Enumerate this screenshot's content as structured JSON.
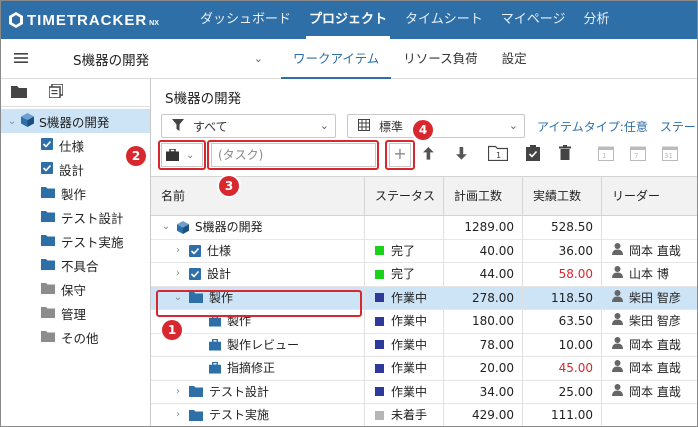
{
  "app": {
    "logo_text": "TIMETRACKER",
    "logo_suffix": "NX"
  },
  "nav": [
    "ダッシュボード",
    "プロジェクト",
    "タイムシート",
    "マイページ",
    "分析"
  ],
  "nav_active": 1,
  "project_select": {
    "value": "S機器の開発"
  },
  "tabs": [
    "ワークアイテム",
    "リソース負荷",
    "設定"
  ],
  "tab_active": 0,
  "tree": {
    "root": "S機器の開発",
    "items": [
      {
        "label": "仕様",
        "icon": "checkbox-icon"
      },
      {
        "label": "設計",
        "icon": "checkbox-icon"
      },
      {
        "label": "製作",
        "icon": "folder-icon"
      },
      {
        "label": "テスト設計",
        "icon": "folder-icon"
      },
      {
        "label": "テスト実施",
        "icon": "folder-icon"
      },
      {
        "label": "不具合",
        "icon": "folder-icon"
      },
      {
        "label": "保守",
        "icon": "folder-gray-icon"
      },
      {
        "label": "管理",
        "icon": "folder-gray-icon"
      },
      {
        "label": "その他",
        "icon": "folder-gray-icon"
      }
    ]
  },
  "main": {
    "title": "S機器の開発",
    "filter_value": "すべて",
    "view_value": "標準",
    "item_type_link": "アイテムタイプ:任意",
    "item_type_more": "ステータ",
    "task_placeholder": "(タスク)",
    "add_label": "+"
  },
  "callouts": [
    "1",
    "2",
    "3",
    "4"
  ],
  "grid": {
    "headers": [
      "名前",
      "ステータス",
      "計画工数",
      "実績工数",
      "リーダー"
    ],
    "rows": [
      {
        "name": "S機器の開発",
        "status": "",
        "plan": "1289.00",
        "actual": "528.50",
        "leader": ""
      },
      {
        "name": "仕様",
        "status": "完了",
        "plan": "40.00",
        "actual": "36.00",
        "leader": "岡本 直哉"
      },
      {
        "name": "設計",
        "status": "完了",
        "plan": "44.00",
        "actual": "58.00",
        "leader": "山本 博"
      },
      {
        "name": "製作",
        "status": "作業中",
        "plan": "278.00",
        "actual": "118.50",
        "leader": "柴田 智彦"
      },
      {
        "name": "製作",
        "status": "作業中",
        "plan": "180.00",
        "actual": "63.50",
        "leader": "柴田 智彦"
      },
      {
        "name": "製作レビュー",
        "status": "作業中",
        "plan": "78.00",
        "actual": "10.00",
        "leader": "岡本 直哉"
      },
      {
        "name": "指摘修正",
        "status": "作業中",
        "plan": "20.00",
        "actual": "45.00",
        "leader": "岡本 直哉"
      },
      {
        "name": "テスト設計",
        "status": "作業中",
        "plan": "34.00",
        "actual": "25.00",
        "leader": "岡本 直哉"
      },
      {
        "name": "テスト実施",
        "status": "未着手",
        "plan": "429.00",
        "actual": "111.00",
        "leader": ""
      }
    ]
  },
  "colors": {
    "brand": "#2f6fa7",
    "done": "#19d219",
    "in_progress": "#2d3a9c",
    "not_started": "#b5b5b5",
    "over": "#d8282f",
    "callout": "#d8282f"
  }
}
